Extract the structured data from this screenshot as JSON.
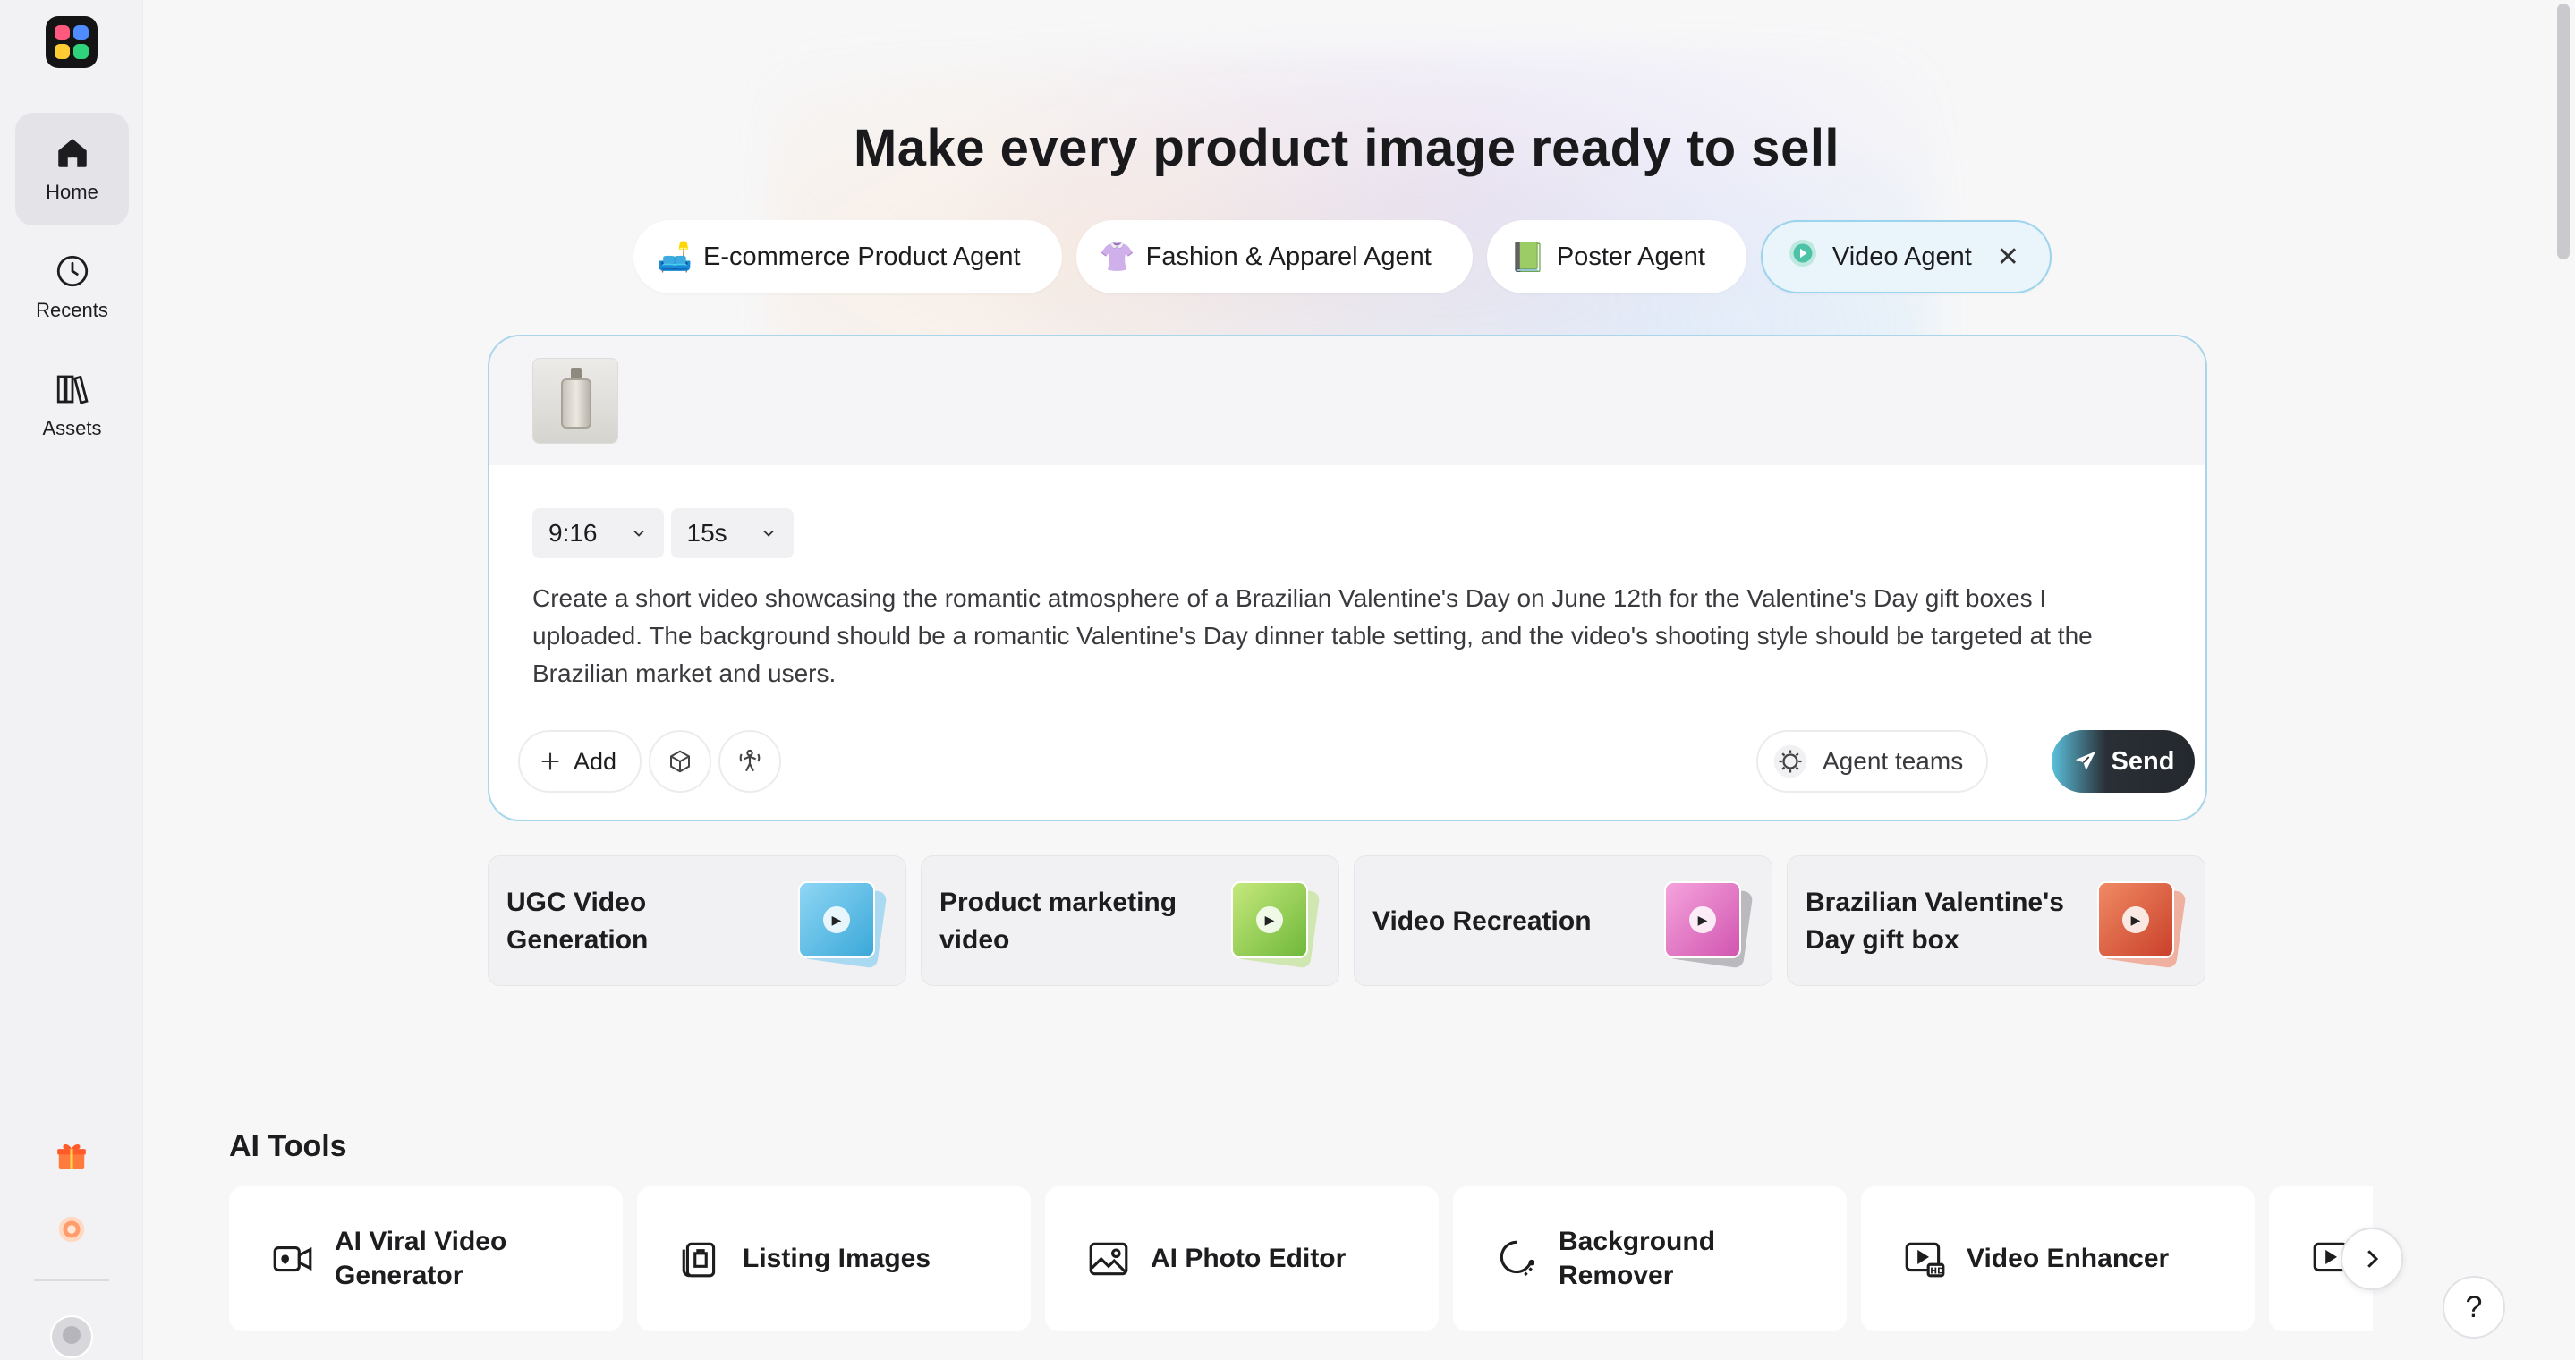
{
  "sidebar": {
    "items": [
      {
        "label": "Home",
        "icon": "home-icon",
        "active": true
      },
      {
        "label": "Recents",
        "icon": "clock-icon"
      },
      {
        "label": "Assets",
        "icon": "library-icon"
      }
    ]
  },
  "hero": {
    "title": "Make every product image ready to sell"
  },
  "agents": [
    {
      "label": "E-commerce Product Agent",
      "emoji": "🛋️"
    },
    {
      "label": "Fashion & Apparel Agent",
      "emoji": "👚"
    },
    {
      "label": "Poster Agent",
      "emoji": "📗"
    },
    {
      "label": "Video Agent",
      "emoji": "",
      "active": true,
      "close": "✕"
    }
  ],
  "prompt": {
    "aspect_ratio": "9:16",
    "duration": "15s",
    "text": "Create a short video showcasing the romantic atmosphere of a Brazilian Valentine's Day on June 12th for the Valentine's Day gift boxes I uploaded. The background should be a romantic Valentine's Day dinner table setting, and the video's shooting style should be targeted at the Brazilian market and users.",
    "add_label": "Add",
    "agent_teams_label": "Agent teams",
    "send_label": "Send"
  },
  "suggestions": [
    {
      "label": "UGC Video Generation",
      "color": "#56b8e6"
    },
    {
      "label": "Product marketing video",
      "color": "#8ccf4a"
    },
    {
      "label": "Video Recreation",
      "color": "#e86cc0"
    },
    {
      "label": "Brazilian Valentine's Day gift box",
      "color": "#e2573a"
    }
  ],
  "tools": {
    "title": "AI Tools",
    "items": [
      {
        "label": "AI Viral Video Generator",
        "icon": "video-camera-icon"
      },
      {
        "label": "Listing Images",
        "icon": "listing-images-icon"
      },
      {
        "label": "AI Photo Editor",
        "icon": "photo-editor-icon"
      },
      {
        "label": "Background Remover",
        "icon": "background-remover-icon"
      },
      {
        "label": "Video Enhancer",
        "icon": "hd-video-icon"
      },
      {
        "label": "",
        "icon": "video-tool-icon"
      }
    ]
  },
  "help_label": "?",
  "colors": {
    "accent_border": "#a9d6ea",
    "send_gradient_start": "#5ac0dc",
    "send_dark": "#24282d"
  }
}
